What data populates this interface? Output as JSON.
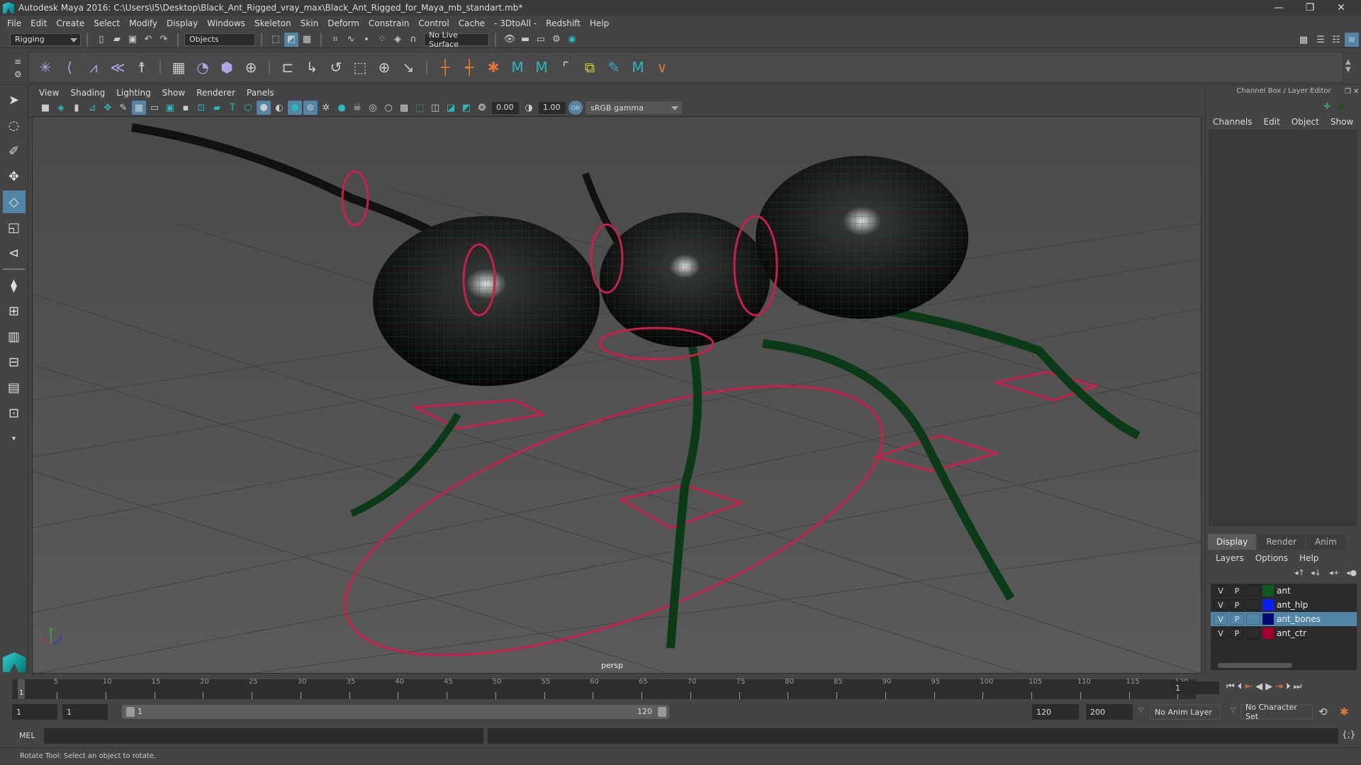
{
  "window": {
    "title": "Autodesk Maya 2016: C:\\Users\\I5\\Desktop\\Black_Ant_Rigged_vray_max\\Black_Ant_Rigged_for_Maya_mb_standart.mb*",
    "controls": [
      "minimize",
      "restore",
      "close"
    ]
  },
  "menubar": [
    "File",
    "Edit",
    "Create",
    "Select",
    "Modify",
    "Display",
    "Windows",
    "Skeleton",
    "Skin",
    "Deform",
    "Constrain",
    "Control",
    "Cache",
    "- 3DtoAll -",
    "Redshift",
    "Help"
  ],
  "statusline": {
    "menuset": "Rigging",
    "selection_mode": "Objects",
    "live_surface": "No Live Surface"
  },
  "shelf": {
    "icons": [
      "joint-tool",
      "ik-handle",
      "ik-spline",
      "insert-joint",
      "humanik",
      "paint-weights",
      "smooth-bind",
      "lattice",
      "cluster",
      "parent-constraint",
      "point-constraint",
      "orient-constraint",
      "scale-constraint",
      "aim-constraint",
      "pole-vector-constraint",
      "set-key",
      "set-key-rotate",
      "character",
      "maya-m1",
      "maya-m2",
      "create-layer",
      "selection-tool",
      "maya-m3",
      "vertex"
    ]
  },
  "toolbox": [
    "select-tool",
    "lasso-tool",
    "paint-select-tool",
    "move-tool",
    "rotate-tool",
    "scale-tool",
    "last-tool",
    "single-view",
    "four-view",
    "outliner-persp",
    "persp-graph",
    "hypershade-persp",
    "persp-graph-outliner",
    "more"
  ],
  "viewport": {
    "menu": [
      "View",
      "Shading",
      "Lighting",
      "Show",
      "Renderer",
      "Panels"
    ],
    "exposure": "0.00",
    "gamma": "1.00",
    "color_management": "ON",
    "view_transform": "sRGB gamma",
    "camera": "persp",
    "axis_labels": {
      "x": "x",
      "y": "y",
      "z": "z"
    }
  },
  "channel_box": {
    "title": "Channel Box / Layer Editor",
    "menu": [
      "Channels",
      "Edit",
      "Object",
      "Show"
    ]
  },
  "layer_editor": {
    "tabs": [
      "Display",
      "Render",
      "Anim"
    ],
    "active_tab": "Display",
    "menu": [
      "Layers",
      "Options",
      "Help"
    ],
    "layers": [
      {
        "v": "V",
        "p": "P",
        "name": "ant",
        "color": "#0d5a22",
        "selected": false
      },
      {
        "v": "V",
        "p": "P",
        "name": "ant_hlp",
        "color": "#0a1eff",
        "selected": false
      },
      {
        "v": "V",
        "p": "P",
        "name": "ant_bones",
        "color": "#000a6e",
        "selected": true
      },
      {
        "v": "V",
        "p": "P",
        "name": "ant_ctr",
        "color": "#a5002d",
        "selected": false
      }
    ]
  },
  "timeline": {
    "ticks": [
      "5",
      "10",
      "15",
      "20",
      "25",
      "30",
      "35",
      "40",
      "45",
      "50",
      "55",
      "60",
      "65",
      "70",
      "75",
      "80",
      "85",
      "90",
      "95",
      "100",
      "105",
      "110",
      "115",
      "120"
    ],
    "current_frame_marker": "1",
    "current_frame": "1"
  },
  "range": {
    "start": "1",
    "playback_start": "1",
    "slider_start": "1",
    "slider_end": "120",
    "playback_end": "120",
    "end": "200",
    "anim_layer": "No Anim Layer",
    "character_set": "No Character Set"
  },
  "command_line": {
    "label": "MEL",
    "value": ""
  },
  "help_line": "Rotate Tool: Select an object to rotate.",
  "colors": {
    "accent": "#5285a6",
    "control_red": "#c8204a",
    "wire_green": "#0f5a22",
    "bone_blue": "#1a1aa0"
  }
}
